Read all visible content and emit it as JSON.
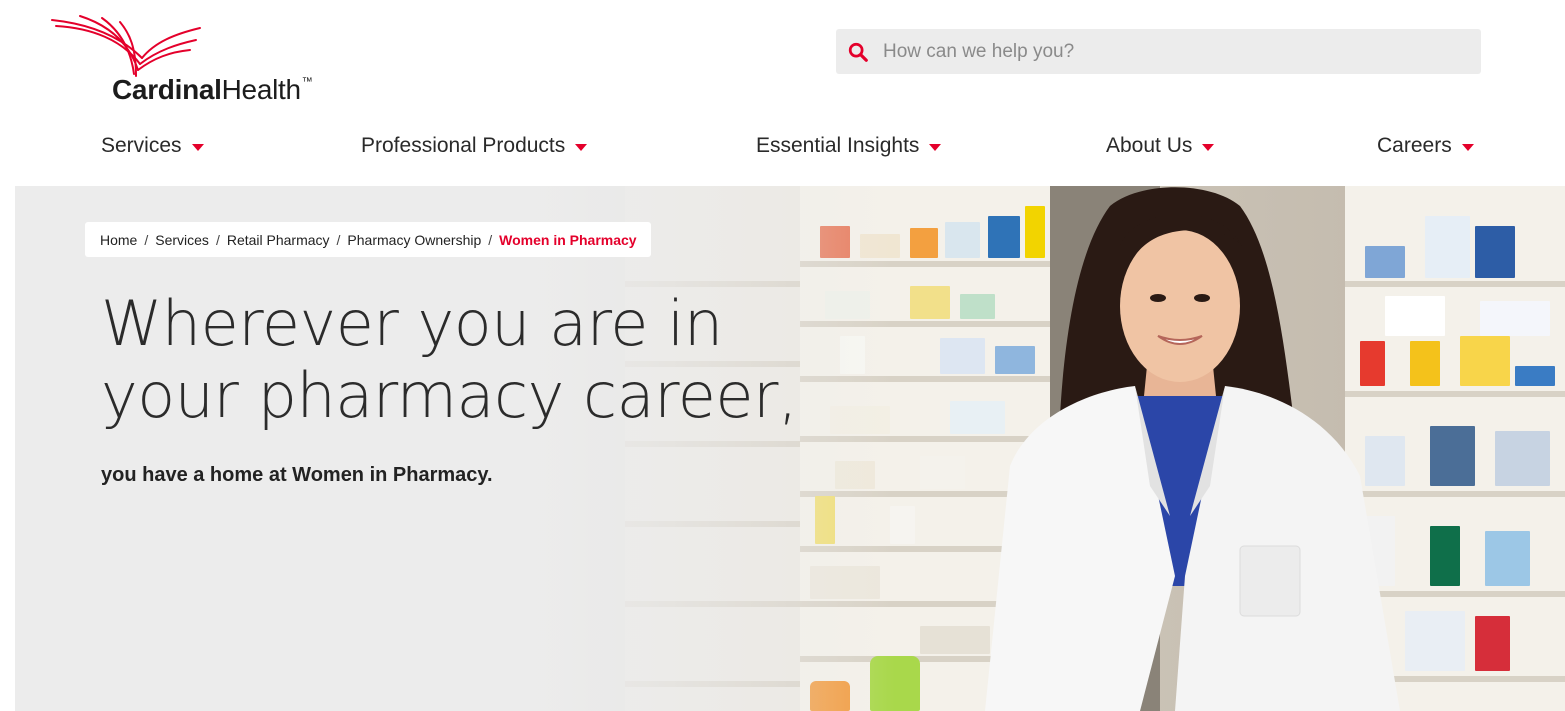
{
  "brand": {
    "name_bold": "Cardinal",
    "name_regular": "Health",
    "trademark": "™",
    "accent_color": "#e4002b"
  },
  "search": {
    "placeholder": "How can we help you?",
    "value": "",
    "icon": "search-icon"
  },
  "nav": {
    "items": [
      {
        "label": "Services",
        "icon": "caret-down-icon"
      },
      {
        "label": "Professional Products",
        "icon": "caret-down-icon"
      },
      {
        "label": "Essential Insights",
        "icon": "caret-down-icon"
      },
      {
        "label": "About Us",
        "icon": "caret-down-icon"
      },
      {
        "label": "Careers",
        "icon": "caret-down-icon"
      }
    ]
  },
  "breadcrumb": {
    "separator": "/",
    "items": [
      "Home",
      "Services",
      "Retail Pharmacy",
      "Pharmacy Ownership"
    ],
    "current": "Women in Pharmacy"
  },
  "hero": {
    "title_line1": "Wherever you are in",
    "title_line2": "your pharmacy career,",
    "subtitle": "you have a home at Women in Pharmacy."
  }
}
